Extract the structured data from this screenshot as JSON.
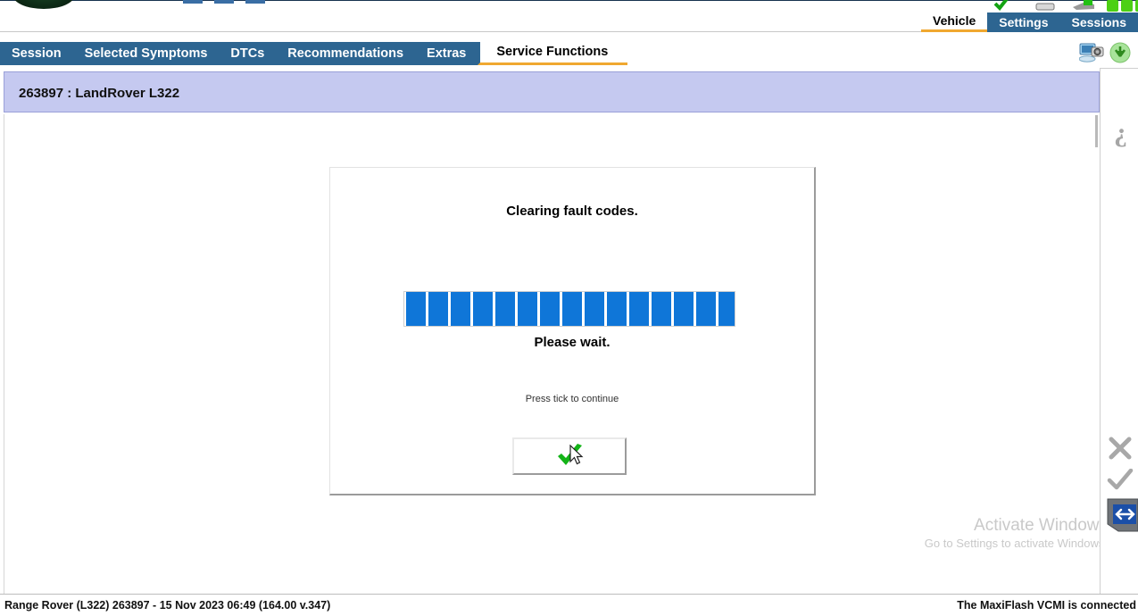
{
  "window": {
    "top_icons": [
      "check-icon",
      "module-icon",
      "cable-icon",
      "green-square-1",
      "green-square-2",
      "green-square-3"
    ]
  },
  "header": {
    "tabs": [
      {
        "label": "Vehicle",
        "active": true
      },
      {
        "label": "Settings",
        "active": false
      },
      {
        "label": "Sessions",
        "active": false
      }
    ]
  },
  "navtabs": {
    "items": [
      {
        "label": "Session",
        "active": false
      },
      {
        "label": "Selected Symptoms",
        "active": false
      },
      {
        "label": "DTCs",
        "active": false
      },
      {
        "label": "Recommendations",
        "active": false
      },
      {
        "label": "Extras",
        "active": false
      },
      {
        "label": "Service Functions",
        "active": true
      }
    ],
    "tools": [
      {
        "name": "screenshot-capture-icon"
      },
      {
        "name": "download-icon"
      }
    ]
  },
  "vehicle_bar": {
    "text": "263897 : LandRover L322"
  },
  "dialog": {
    "title": "Clearing fault codes.",
    "wait_text": "Please wait.",
    "hint_text": "Press tick to continue",
    "progress": {
      "segments_filled": 15,
      "segment_color": "#0f76d8",
      "percent": 100
    },
    "confirm_button": {
      "name": "tick-confirm-button",
      "icon": "green-check-icon"
    }
  },
  "watermark": {
    "line1": "Activate Windows",
    "line2": "Go to Settings to activate Windows."
  },
  "sidebar": {
    "items": [
      {
        "name": "help-question-icon",
        "label": "?"
      },
      {
        "name": "cancel-x-icon",
        "label": "X"
      },
      {
        "name": "confirm-check-icon",
        "label": "Tick"
      },
      {
        "name": "back-arrow-button",
        "label": "Back"
      }
    ]
  },
  "statusbar": {
    "left": "Range Rover (L322) 263897 - 15 Nov 2023 06:49 (164.00 v.347)",
    "right": "The MaxiFlash VCMI is connected"
  },
  "colors": {
    "tab_blue": "#2d6591",
    "accent_orange": "#f0a830",
    "vehicle_bar_bg": "#c5c9f0",
    "progress_blue": "#0f76d8",
    "green_check": "#13b317"
  }
}
